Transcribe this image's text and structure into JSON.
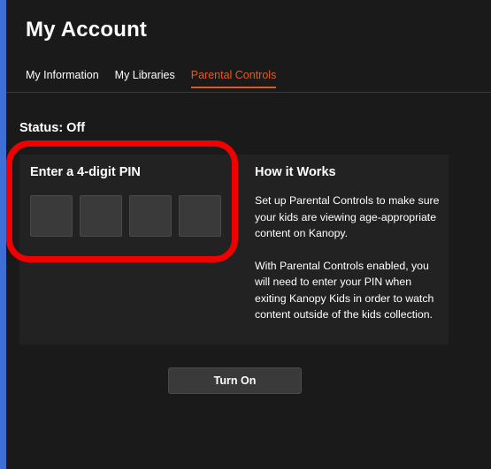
{
  "header": {
    "title": "My Account"
  },
  "tabs": [
    {
      "label": "My Information",
      "active": false
    },
    {
      "label": "My Libraries",
      "active": false
    },
    {
      "label": "Parental Controls",
      "active": true
    }
  ],
  "status": {
    "text": "Status: Off"
  },
  "pin": {
    "title": "Enter a 4-digit PIN",
    "digits": [
      "",
      "",
      "",
      ""
    ]
  },
  "how_it_works": {
    "title": "How it Works",
    "paragraphs": [
      "Set up Parental Controls to make sure your kids are viewing age-appropriate content on Kanopy.",
      "With Parental Controls enabled, you will need to enter your PIN when exiting Kanopy Kids in order to watch content outside of the kids collection."
    ]
  },
  "actions": {
    "turn_on_label": "Turn On"
  },
  "colors": {
    "background": "#1a1a1a",
    "card": "#222222",
    "accent": "#e05a25",
    "highlight": "#f00000",
    "window_frame": "#2f63c9"
  }
}
